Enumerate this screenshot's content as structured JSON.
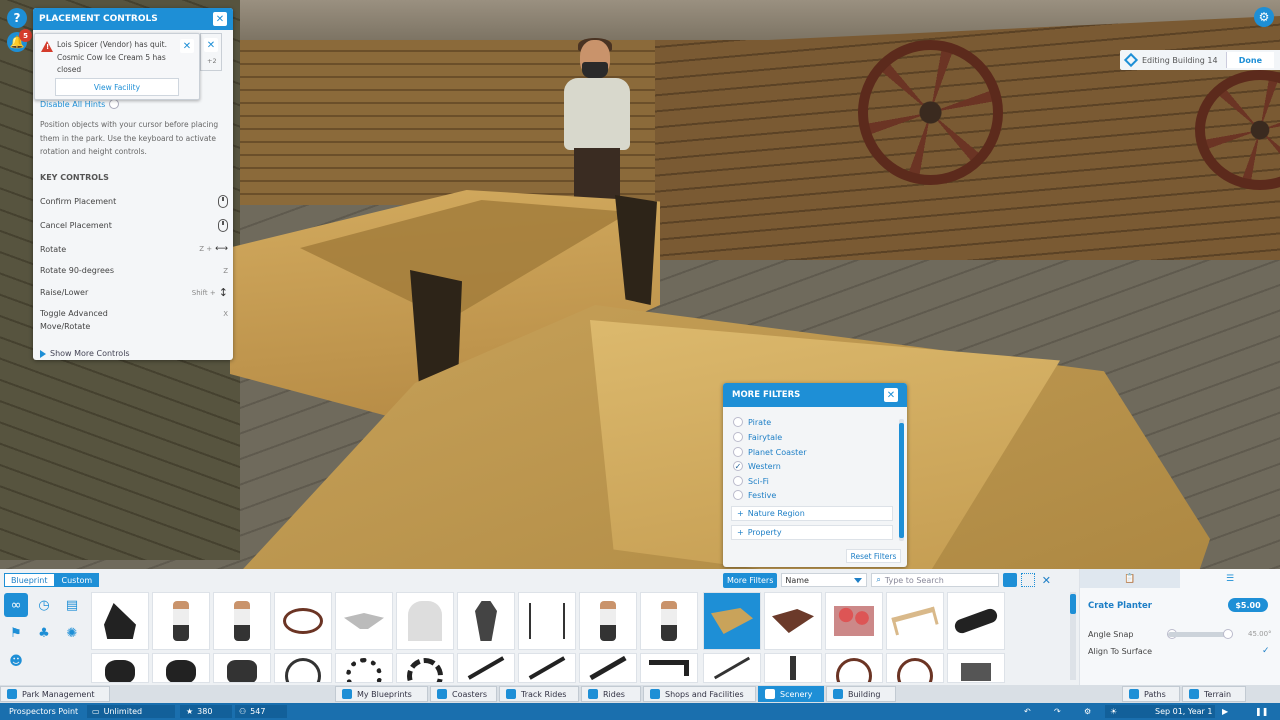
{
  "topLeft": {
    "help_glyph": "?",
    "notifications_count": "5"
  },
  "settings_glyph": "⚙",
  "editing": {
    "label": "Editing Building 14",
    "done_label": "Done"
  },
  "placement": {
    "title": "PLACEMENT CONTROLS",
    "disable_hints": "Disable All Hints",
    "description": "Position objects with your cursor before placing them in the park. Use the keyboard to activate rotation and height controls.",
    "key_controls_heading": "KEY CONTROLS",
    "controls": [
      {
        "label": "Confirm Placement",
        "key": ""
      },
      {
        "label": "Cancel Placement",
        "key": ""
      },
      {
        "label": "Rotate",
        "key": "Z +"
      },
      {
        "label": "Rotate 90-degrees",
        "key": "Z"
      },
      {
        "label": "Raise/Lower",
        "key": "Shift +"
      },
      {
        "label": "Toggle Advanced Move/Rotate",
        "key": "X"
      }
    ],
    "show_more": "Show More Controls"
  },
  "notification": {
    "message": "Lois Spicer (Vendor) has quit. Cosmic Cow Ice Cream 5 has closed",
    "button": "View Facility",
    "extra_count": "+2"
  },
  "filters": {
    "title": "MORE FILTERS",
    "options": [
      {
        "label": "Pirate",
        "checked": false
      },
      {
        "label": "Fairytale",
        "checked": false
      },
      {
        "label": "Planet Coaster",
        "checked": false
      },
      {
        "label": "Western",
        "checked": true
      },
      {
        "label": "Sci-Fi",
        "checked": false
      },
      {
        "label": "Festive",
        "checked": false
      }
    ],
    "expanders": [
      "Nature Region",
      "Property"
    ],
    "reset": "Reset Filters"
  },
  "browser": {
    "tabs": [
      {
        "label": "Blueprint",
        "active": false
      },
      {
        "label": "Custom",
        "active": true
      }
    ],
    "more_filters": "More Filters",
    "sort": "Name",
    "search_placeholder": "Type to Search"
  },
  "selected_item": {
    "name": "Crate Planter",
    "price": "$5.00",
    "angle_snap_label": "Angle Snap",
    "angle_value": "45.00°",
    "align_label": "Align To Surface",
    "align_checked": true
  },
  "nav": {
    "park_management": "Park Management",
    "items": [
      {
        "label": "My Blueprints",
        "active": false
      },
      {
        "label": "Coasters",
        "active": false
      },
      {
        "label": "Track Rides",
        "active": false
      },
      {
        "label": "Rides",
        "active": false
      },
      {
        "label": "Shops and Facilities",
        "active": false
      },
      {
        "label": "Scenery",
        "active": true
      },
      {
        "label": "Building",
        "active": false
      }
    ],
    "paths": "Paths",
    "terrain": "Terrain"
  },
  "status": {
    "park_name": "Prospectors Point",
    "money": "Unlimited",
    "rating": "380",
    "guests": "547",
    "date": "Sep 01, Year 1"
  }
}
